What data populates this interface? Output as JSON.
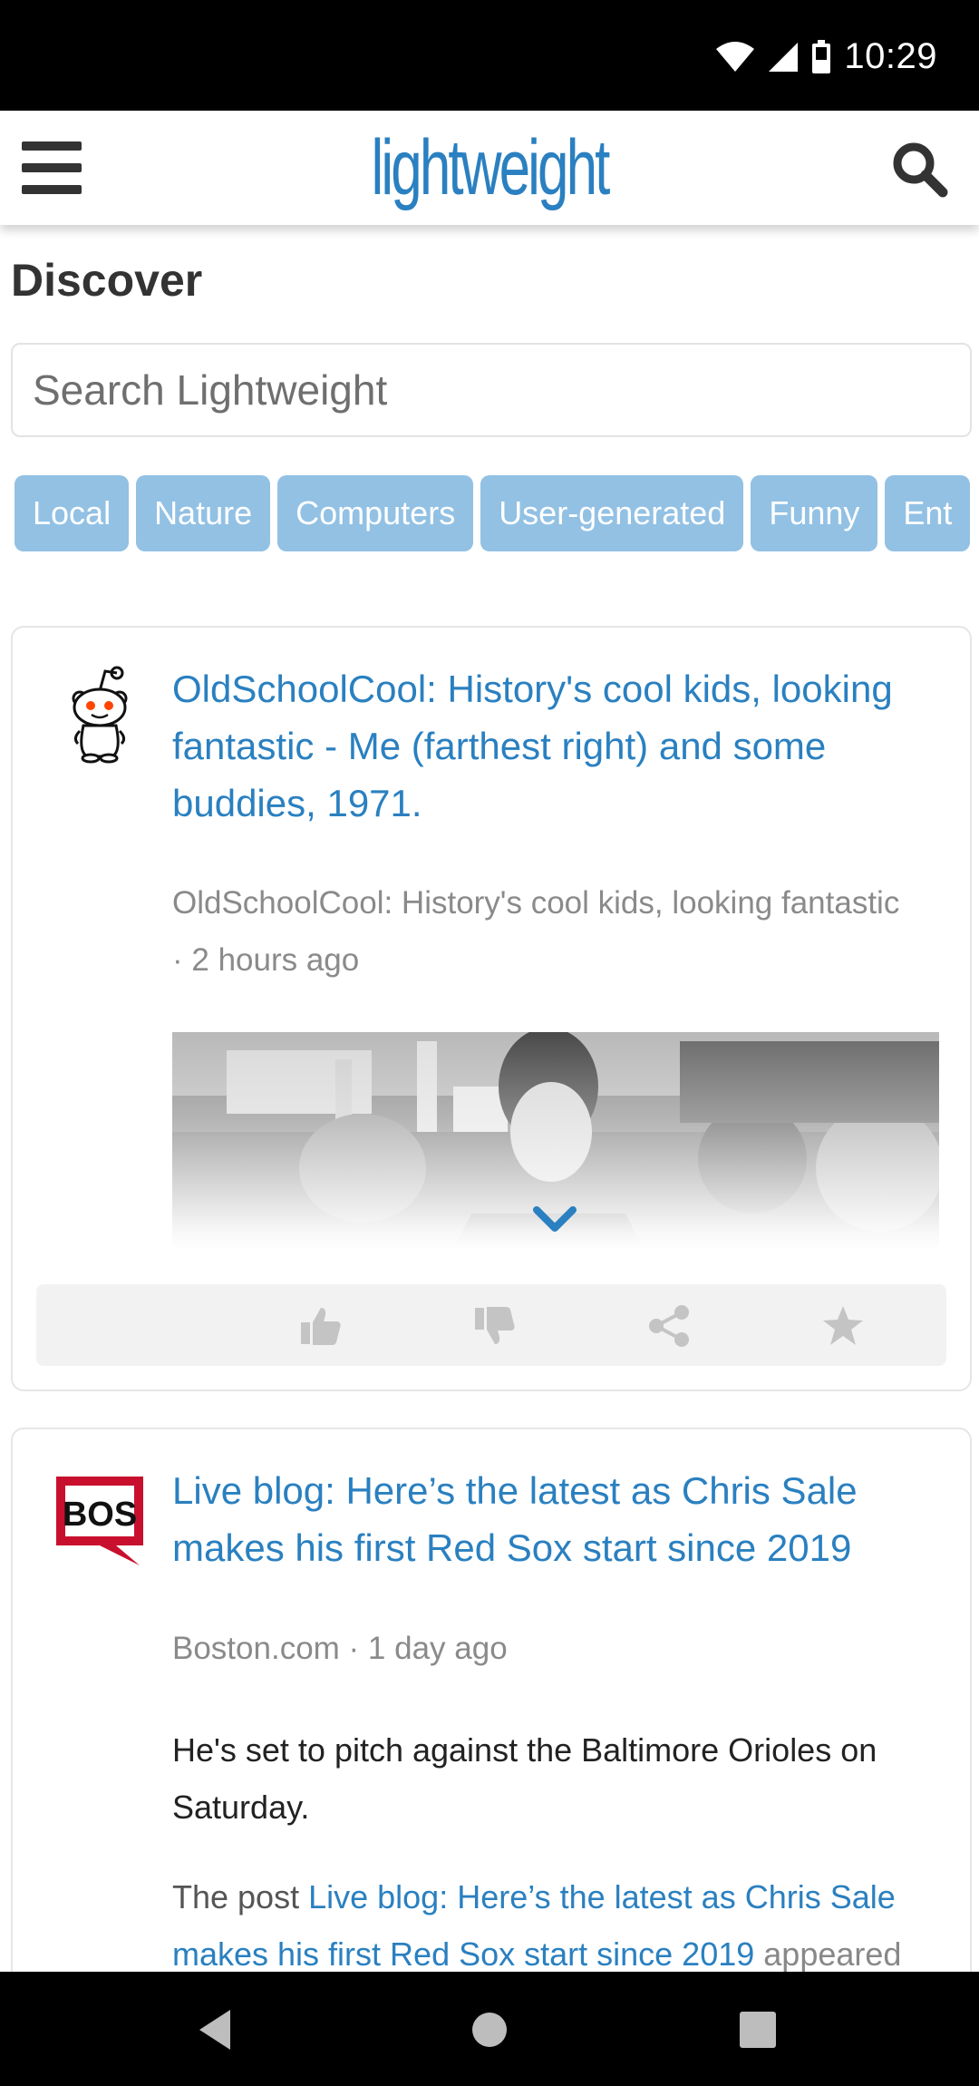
{
  "status_bar": {
    "time": "10:29"
  },
  "app_bar": {
    "brand": "lightweight"
  },
  "page": {
    "title": "Discover"
  },
  "search": {
    "placeholder": "Search Lightweight"
  },
  "categories": [
    "Local",
    "Nature",
    "Computers",
    "User-generated",
    "Funny",
    "Ent"
  ],
  "posts": [
    {
      "title": "OldSchoolCool: History's cool kids, looking fantastic - Me (farthest right) and some buddies, 1971.",
      "source_line": "OldSchoolCool: History's cool kids, looking fantastic",
      "time_line": "· 2 hours ago",
      "icon": "reddit-alien-icon"
    },
    {
      "title": "Live blog: Here’s the latest as Chris Sale makes his first Red Sox start since 2019",
      "source_line": "Boston.com · 1 day ago",
      "body": "He's set to pitch against the Baltimore Orioles on Saturday.",
      "body2_prefix": "The post ",
      "body2_link": "Live blog: Here’s the latest as Chris Sale makes his first Red Sox start since 2019",
      "body2_suffix": " appeared",
      "logo_text": "BOS"
    }
  ],
  "actions": [
    "thumbs-up-icon",
    "thumbs-down-icon",
    "share-icon",
    "star-icon"
  ],
  "colors": {
    "accent": "#2a80c0",
    "chip": "#92c1e4",
    "logo_red": "#c8102e"
  }
}
